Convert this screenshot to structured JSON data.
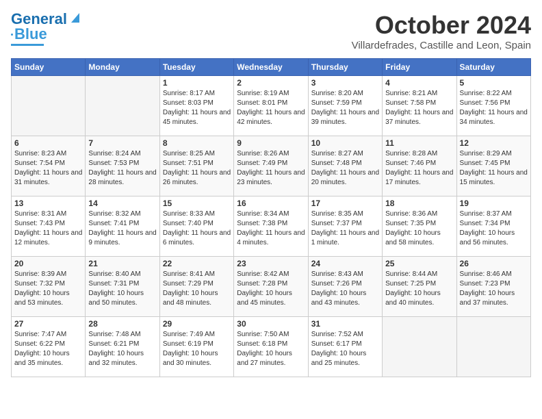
{
  "header": {
    "logo": {
      "line1": "General",
      "line2": "Blue"
    },
    "title": "October 2024",
    "location": "Villardefrades, Castille and Leon, Spain"
  },
  "days_of_week": [
    "Sunday",
    "Monday",
    "Tuesday",
    "Wednesday",
    "Thursday",
    "Friday",
    "Saturday"
  ],
  "weeks": [
    [
      {
        "day": "",
        "sunrise": "",
        "sunset": "",
        "daylight": ""
      },
      {
        "day": "",
        "sunrise": "",
        "sunset": "",
        "daylight": ""
      },
      {
        "day": "1",
        "sunrise": "Sunrise: 8:17 AM",
        "sunset": "Sunset: 8:03 PM",
        "daylight": "Daylight: 11 hours and 45 minutes."
      },
      {
        "day": "2",
        "sunrise": "Sunrise: 8:19 AM",
        "sunset": "Sunset: 8:01 PM",
        "daylight": "Daylight: 11 hours and 42 minutes."
      },
      {
        "day": "3",
        "sunrise": "Sunrise: 8:20 AM",
        "sunset": "Sunset: 7:59 PM",
        "daylight": "Daylight: 11 hours and 39 minutes."
      },
      {
        "day": "4",
        "sunrise": "Sunrise: 8:21 AM",
        "sunset": "Sunset: 7:58 PM",
        "daylight": "Daylight: 11 hours and 37 minutes."
      },
      {
        "day": "5",
        "sunrise": "Sunrise: 8:22 AM",
        "sunset": "Sunset: 7:56 PM",
        "daylight": "Daylight: 11 hours and 34 minutes."
      }
    ],
    [
      {
        "day": "6",
        "sunrise": "Sunrise: 8:23 AM",
        "sunset": "Sunset: 7:54 PM",
        "daylight": "Daylight: 11 hours and 31 minutes."
      },
      {
        "day": "7",
        "sunrise": "Sunrise: 8:24 AM",
        "sunset": "Sunset: 7:53 PM",
        "daylight": "Daylight: 11 hours and 28 minutes."
      },
      {
        "day": "8",
        "sunrise": "Sunrise: 8:25 AM",
        "sunset": "Sunset: 7:51 PM",
        "daylight": "Daylight: 11 hours and 26 minutes."
      },
      {
        "day": "9",
        "sunrise": "Sunrise: 8:26 AM",
        "sunset": "Sunset: 7:49 PM",
        "daylight": "Daylight: 11 hours and 23 minutes."
      },
      {
        "day": "10",
        "sunrise": "Sunrise: 8:27 AM",
        "sunset": "Sunset: 7:48 PM",
        "daylight": "Daylight: 11 hours and 20 minutes."
      },
      {
        "day": "11",
        "sunrise": "Sunrise: 8:28 AM",
        "sunset": "Sunset: 7:46 PM",
        "daylight": "Daylight: 11 hours and 17 minutes."
      },
      {
        "day": "12",
        "sunrise": "Sunrise: 8:29 AM",
        "sunset": "Sunset: 7:45 PM",
        "daylight": "Daylight: 11 hours and 15 minutes."
      }
    ],
    [
      {
        "day": "13",
        "sunrise": "Sunrise: 8:31 AM",
        "sunset": "Sunset: 7:43 PM",
        "daylight": "Daylight: 11 hours and 12 minutes."
      },
      {
        "day": "14",
        "sunrise": "Sunrise: 8:32 AM",
        "sunset": "Sunset: 7:41 PM",
        "daylight": "Daylight: 11 hours and 9 minutes."
      },
      {
        "day": "15",
        "sunrise": "Sunrise: 8:33 AM",
        "sunset": "Sunset: 7:40 PM",
        "daylight": "Daylight: 11 hours and 6 minutes."
      },
      {
        "day": "16",
        "sunrise": "Sunrise: 8:34 AM",
        "sunset": "Sunset: 7:38 PM",
        "daylight": "Daylight: 11 hours and 4 minutes."
      },
      {
        "day": "17",
        "sunrise": "Sunrise: 8:35 AM",
        "sunset": "Sunset: 7:37 PM",
        "daylight": "Daylight: 11 hours and 1 minute."
      },
      {
        "day": "18",
        "sunrise": "Sunrise: 8:36 AM",
        "sunset": "Sunset: 7:35 PM",
        "daylight": "Daylight: 10 hours and 58 minutes."
      },
      {
        "day": "19",
        "sunrise": "Sunrise: 8:37 AM",
        "sunset": "Sunset: 7:34 PM",
        "daylight": "Daylight: 10 hours and 56 minutes."
      }
    ],
    [
      {
        "day": "20",
        "sunrise": "Sunrise: 8:39 AM",
        "sunset": "Sunset: 7:32 PM",
        "daylight": "Daylight: 10 hours and 53 minutes."
      },
      {
        "day": "21",
        "sunrise": "Sunrise: 8:40 AM",
        "sunset": "Sunset: 7:31 PM",
        "daylight": "Daylight: 10 hours and 50 minutes."
      },
      {
        "day": "22",
        "sunrise": "Sunrise: 8:41 AM",
        "sunset": "Sunset: 7:29 PM",
        "daylight": "Daylight: 10 hours and 48 minutes."
      },
      {
        "day": "23",
        "sunrise": "Sunrise: 8:42 AM",
        "sunset": "Sunset: 7:28 PM",
        "daylight": "Daylight: 10 hours and 45 minutes."
      },
      {
        "day": "24",
        "sunrise": "Sunrise: 8:43 AM",
        "sunset": "Sunset: 7:26 PM",
        "daylight": "Daylight: 10 hours and 43 minutes."
      },
      {
        "day": "25",
        "sunrise": "Sunrise: 8:44 AM",
        "sunset": "Sunset: 7:25 PM",
        "daylight": "Daylight: 10 hours and 40 minutes."
      },
      {
        "day": "26",
        "sunrise": "Sunrise: 8:46 AM",
        "sunset": "Sunset: 7:23 PM",
        "daylight": "Daylight: 10 hours and 37 minutes."
      }
    ],
    [
      {
        "day": "27",
        "sunrise": "Sunrise: 7:47 AM",
        "sunset": "Sunset: 6:22 PM",
        "daylight": "Daylight: 10 hours and 35 minutes."
      },
      {
        "day": "28",
        "sunrise": "Sunrise: 7:48 AM",
        "sunset": "Sunset: 6:21 PM",
        "daylight": "Daylight: 10 hours and 32 minutes."
      },
      {
        "day": "29",
        "sunrise": "Sunrise: 7:49 AM",
        "sunset": "Sunset: 6:19 PM",
        "daylight": "Daylight: 10 hours and 30 minutes."
      },
      {
        "day": "30",
        "sunrise": "Sunrise: 7:50 AM",
        "sunset": "Sunset: 6:18 PM",
        "daylight": "Daylight: 10 hours and 27 minutes."
      },
      {
        "day": "31",
        "sunrise": "Sunrise: 7:52 AM",
        "sunset": "Sunset: 6:17 PM",
        "daylight": "Daylight: 10 hours and 25 minutes."
      },
      {
        "day": "",
        "sunrise": "",
        "sunset": "",
        "daylight": ""
      },
      {
        "day": "",
        "sunrise": "",
        "sunset": "",
        "daylight": ""
      }
    ]
  ]
}
